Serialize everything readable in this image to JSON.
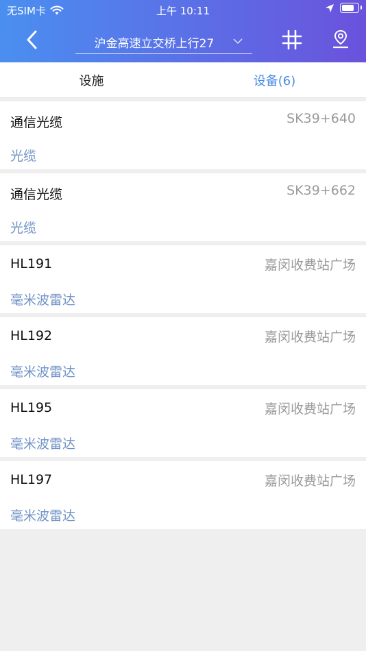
{
  "status_bar": {
    "carrier": "无SIM卡",
    "time": "上午 10:11",
    "battery_level": 0.85
  },
  "nav": {
    "title": "沪金高速立交桥上行27",
    "icons": [
      "back-chevron-icon",
      "chevron-down-icon",
      "grid-icon",
      "map-pin-icon"
    ]
  },
  "tabs": [
    {
      "label": "设施",
      "active": false
    },
    {
      "label": "设备(6)",
      "active": true
    }
  ],
  "items": [
    {
      "name": "通信光缆",
      "location": "SK39+640",
      "type": "光缆"
    },
    {
      "name": "通信光缆",
      "location": "SK39+662",
      "type": "光缆"
    },
    {
      "name": "HL191",
      "location": "嘉闵收费站广场",
      "type": "毫米波雷达"
    },
    {
      "name": "HL192",
      "location": "嘉闵收费站广场",
      "type": "毫米波雷达"
    },
    {
      "name": "HL195",
      "location": "嘉闵收费站广场",
      "type": "毫米波雷达"
    },
    {
      "name": "HL197",
      "location": "嘉闵收费站广场",
      "type": "毫米波雷达"
    }
  ],
  "colors": {
    "header_gradient_start": "#4a8ff0",
    "header_gradient_end": "#6a52dc",
    "active_tab": "#4a8ce6",
    "type_text": "#6f93c6",
    "location_text": "#9a9a9a",
    "background": "#efefef"
  }
}
